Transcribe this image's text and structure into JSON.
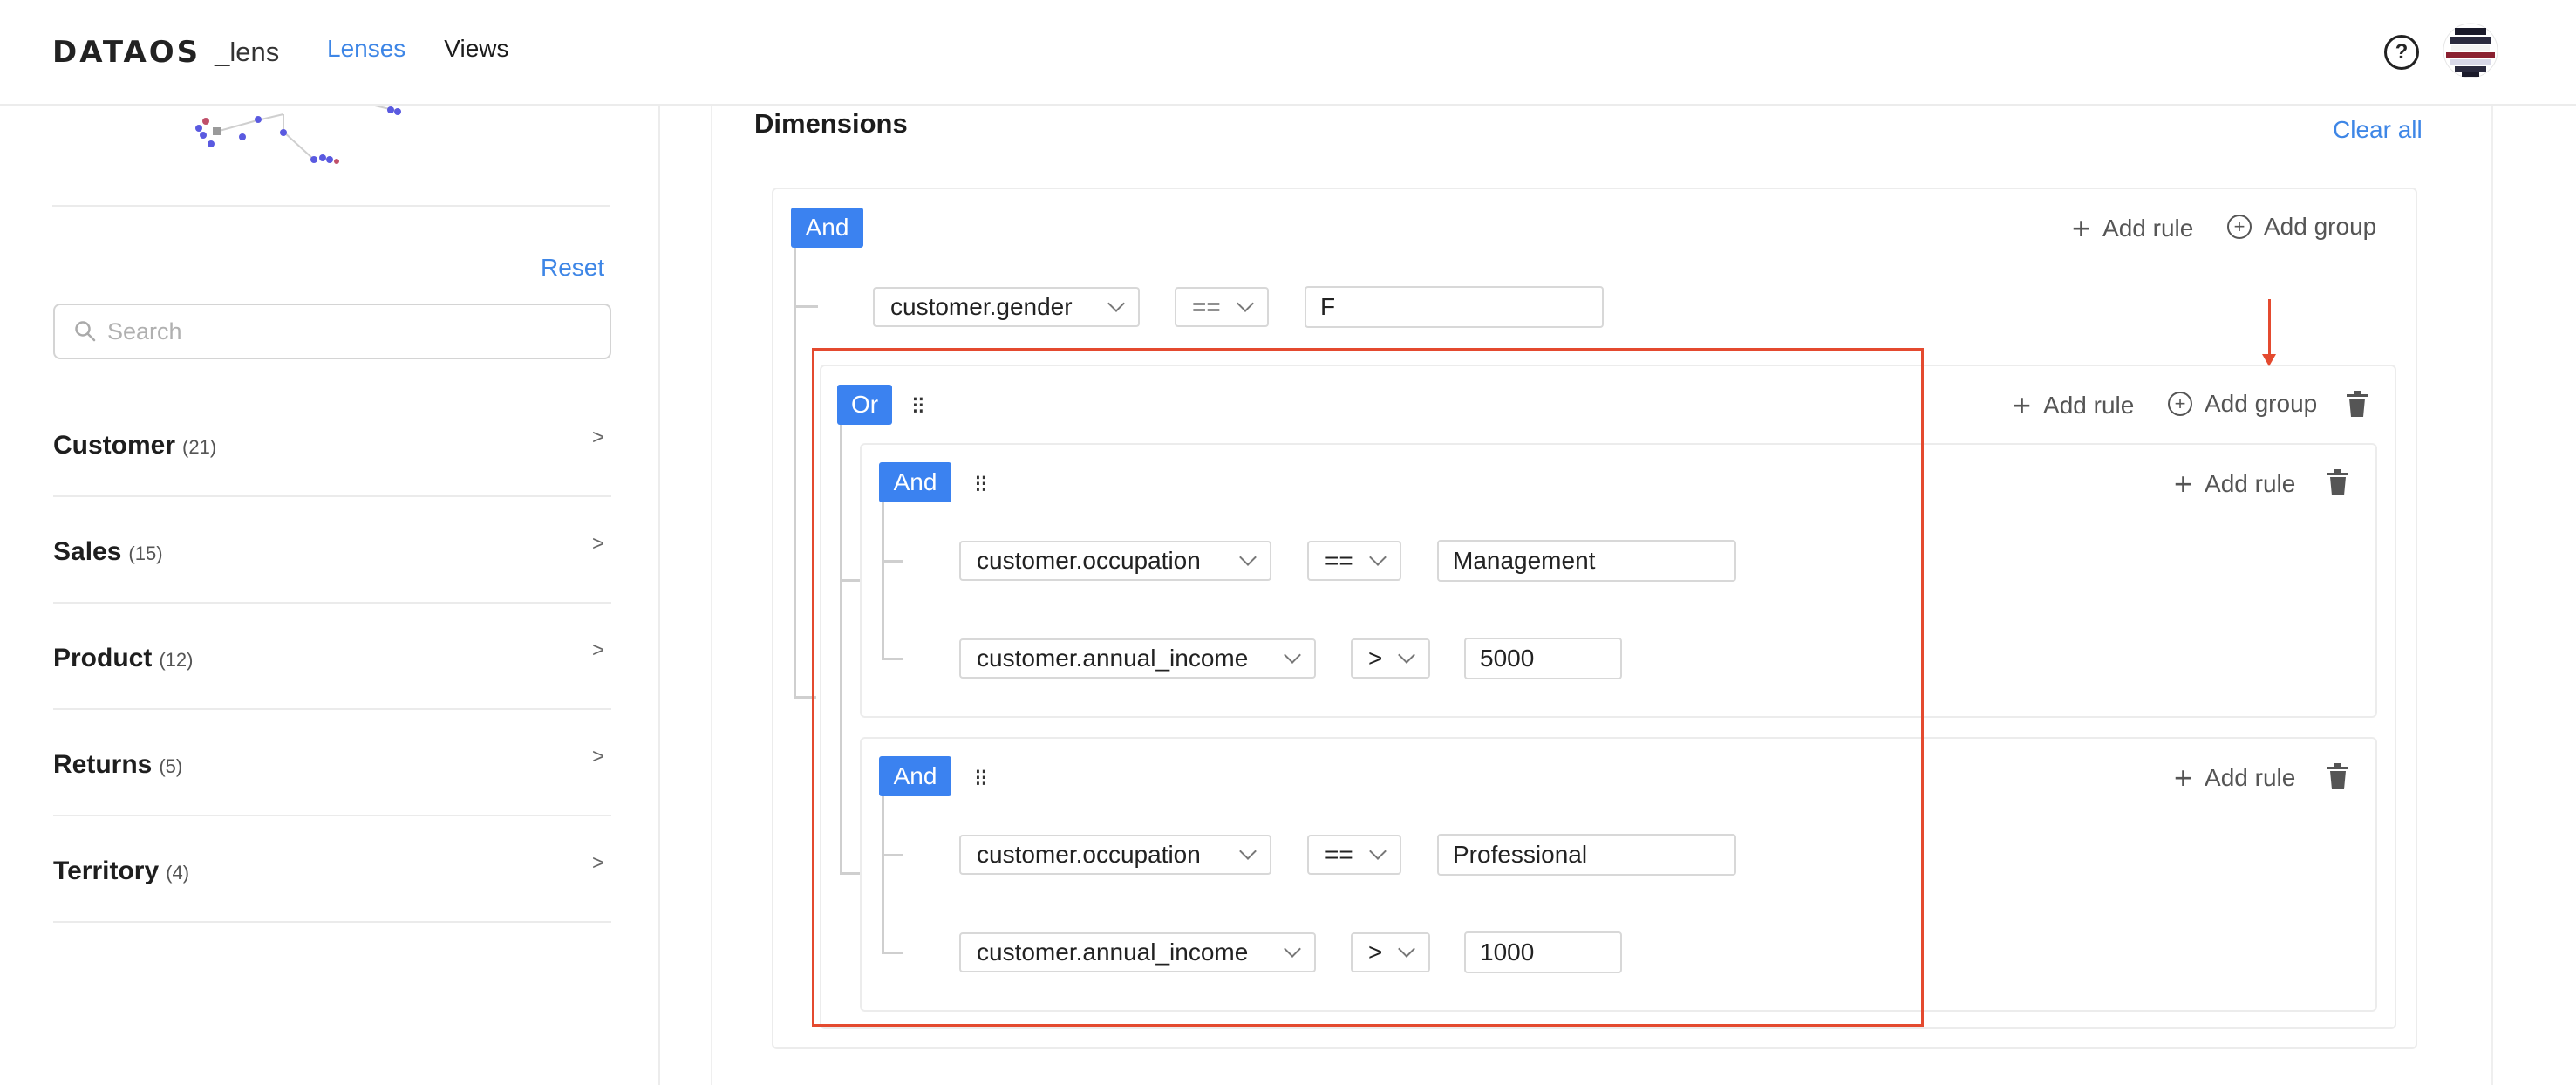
{
  "header": {
    "logo_brand": "DATAOS",
    "logo_product": "_lens",
    "nav": [
      {
        "label": "Lenses",
        "active": true
      },
      {
        "label": "Views",
        "active": false
      }
    ],
    "help_icon": "?"
  },
  "sidebar": {
    "reset_label": "Reset",
    "search_placeholder": "Search",
    "categories": [
      {
        "name": "Customer",
        "count": "(21)"
      },
      {
        "name": "Sales",
        "count": "(15)"
      },
      {
        "name": "Product",
        "count": "(12)"
      },
      {
        "name": "Returns",
        "count": "(5)"
      },
      {
        "name": "Territory",
        "count": "(4)"
      }
    ]
  },
  "main": {
    "title": "Dimensions",
    "clear_all": "Clear all",
    "root": {
      "combinator": "And",
      "add_rule": "Add rule",
      "add_group": "Add group",
      "rule": {
        "field": "customer.gender",
        "op": "==",
        "value": "F"
      },
      "group": {
        "combinator": "Or",
        "add_rule": "Add rule",
        "add_group": "Add group",
        "subgroups": [
          {
            "combinator": "And",
            "add_rule": "Add rule",
            "rules": [
              {
                "field": "customer.occupation",
                "op": "==",
                "value": "Management"
              },
              {
                "field": "customer.annual_income",
                "op": ">",
                "value": "5000"
              }
            ]
          },
          {
            "combinator": "And",
            "add_rule": "Add rule",
            "rules": [
              {
                "field": "customer.occupation",
                "op": "==",
                "value": "Professional"
              },
              {
                "field": "customer.annual_income",
                "op": ">",
                "value": "1000"
              }
            ]
          }
        ]
      }
    }
  },
  "colors": {
    "accent": "#3e86e6",
    "combinator_bg": "#3b82f0",
    "highlight": "#e44a2f"
  }
}
